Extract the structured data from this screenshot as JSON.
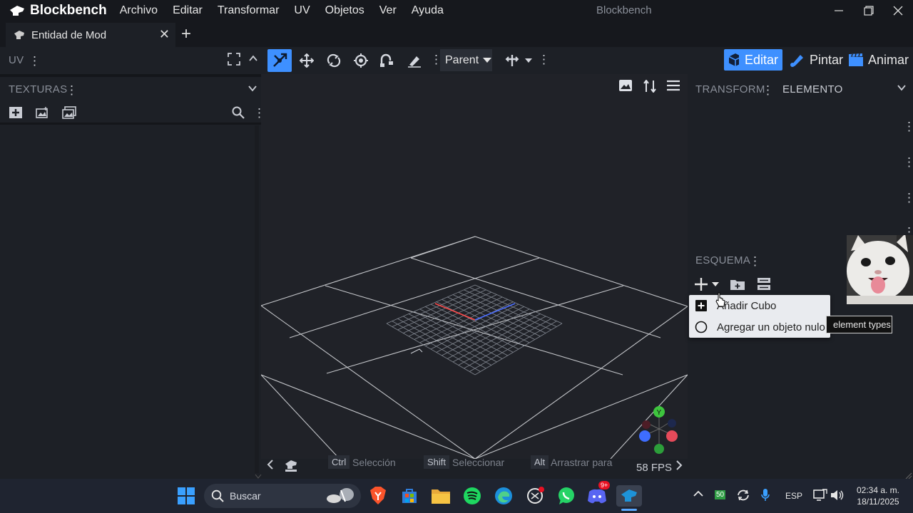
{
  "app": {
    "name": "Blockbench",
    "window_title": "Blockbench",
    "menu": [
      "Archivo",
      "Editar",
      "Transformar",
      "UV",
      "Objetos",
      "Ver",
      "Ayuda"
    ]
  },
  "tab": {
    "label": "Entidad de Mod"
  },
  "left_panel": {
    "uv_title": "UV",
    "textures_title": "TEXTURAS"
  },
  "toolbar": {
    "parent_label": "Parent",
    "modes": [
      "Editar",
      "Pintar",
      "Animar"
    ]
  },
  "right_panel": {
    "transform_tab": "TRANSFORM",
    "element_tab": "ELEMENTO",
    "outliner_title": "ESQUEMA"
  },
  "dropdown": {
    "items": [
      "Añadir Cubo",
      "Agregar un objeto nulo"
    ]
  },
  "tooltip": {
    "text": "element types"
  },
  "statusbar": {
    "hints": [
      {
        "key": "Ctrl",
        "text": "Selección múltiple"
      },
      {
        "key": "Shift",
        "text": "Seleccionar rango"
      },
      {
        "key": "Alt",
        "text": "Arrastrar para duplicar"
      }
    ],
    "fps": "58 FPS"
  },
  "taskbar": {
    "search_placeholder": "Buscar",
    "badge": "9+",
    "tray_label": "50",
    "language": "ESP",
    "time": "02:34 a. m.",
    "date": "18/11/2025"
  },
  "colors": {
    "accent": "#3e90ff",
    "background": "#1d2026",
    "viewport": "#202228"
  }
}
